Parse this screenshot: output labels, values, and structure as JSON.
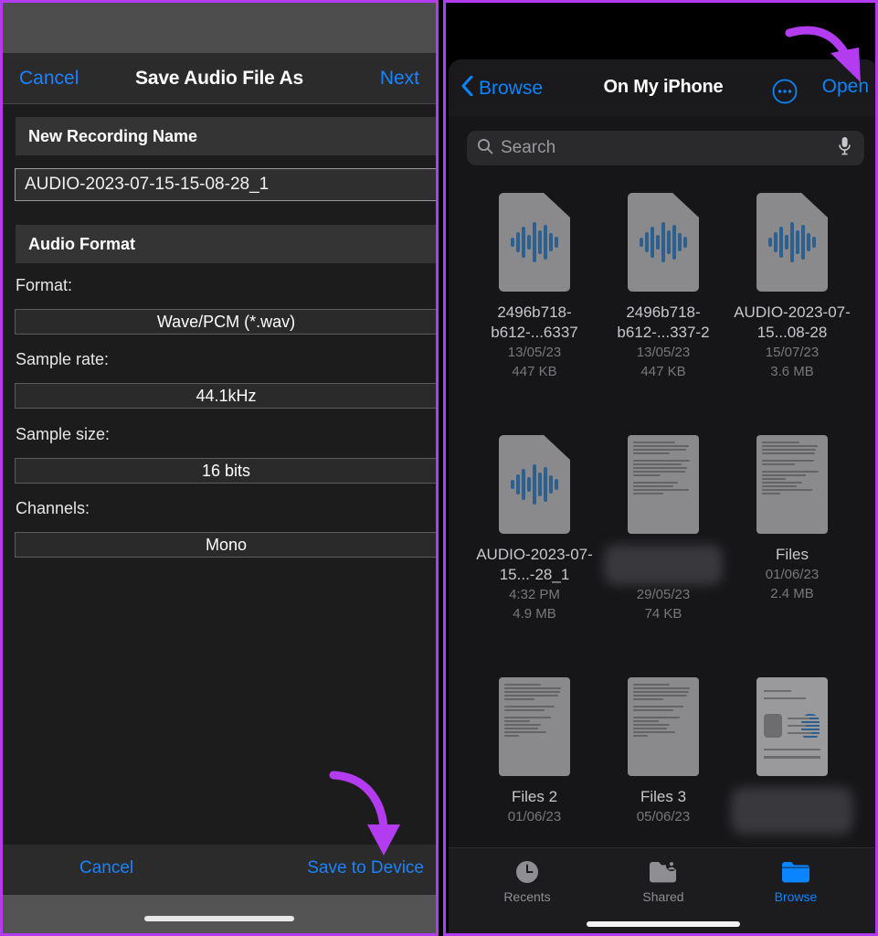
{
  "annotation": {
    "arrow_color": "#b43cf0",
    "border_color": "#b43cf0"
  },
  "left_panel": {
    "header": {
      "cancel_label": "Cancel",
      "title": "Save Audio File As",
      "next_label": "Next"
    },
    "name_section": {
      "section_header": "New Recording Name",
      "input_value": "AUDIO-2023-07-15-15-08-28_1"
    },
    "format_section": {
      "section_header": "Audio Format",
      "fields": [
        {
          "label": "Format:",
          "value": "Wave/PCM (*.wav)"
        },
        {
          "label": "Sample rate:",
          "value": "44.1kHz"
        },
        {
          "label": "Sample size:",
          "value": "16 bits"
        },
        {
          "label": "Channels:",
          "value": "Mono"
        }
      ]
    },
    "footer": {
      "cancel_label": "Cancel",
      "save_label": "Save to Device"
    },
    "accent_color": "#1a84ff"
  },
  "right_panel": {
    "header": {
      "back_label": "Browse",
      "back_icon": "chevron-left-icon",
      "title": "On My iPhone",
      "more_icon": "ellipsis-circle-icon",
      "open_label": "Open"
    },
    "search": {
      "placeholder": "Search",
      "search_icon": "magnifier-icon",
      "mic_icon": "microphone-icon"
    },
    "files": [
      {
        "name": "2496b718-b612-...6337",
        "date": "13/05/23",
        "size": "447 KB",
        "kind": "audio",
        "blurred": false
      },
      {
        "name": "2496b718-b612-...337-2",
        "date": "13/05/23",
        "size": "447 KB",
        "kind": "audio",
        "blurred": false
      },
      {
        "name": "AUDIO-2023-07-15...08-28",
        "date": "15/07/23",
        "size": "3.6 MB",
        "kind": "audio",
        "blurred": false
      },
      {
        "name": "AUDIO-2023-07-15...-28_1",
        "date": "4:32 PM",
        "size": "4.9 MB",
        "kind": "audio",
        "blurred": false
      },
      {
        "name": "",
        "date": "29/05/23",
        "size": "74 KB",
        "kind": "document",
        "blurred": true
      },
      {
        "name": "Files",
        "date": "01/06/23",
        "size": "2.4 MB",
        "kind": "document",
        "blurred": false
      },
      {
        "name": "Files 2",
        "date": "01/06/23",
        "size": "",
        "kind": "document",
        "blurred": false
      },
      {
        "name": "Files 3",
        "date": "05/06/23",
        "size": "",
        "kind": "document",
        "blurred": false
      },
      {
        "name": "",
        "date": "",
        "size": "",
        "kind": "idcard",
        "blurred": true
      }
    ],
    "tabs": [
      {
        "label": "Recents",
        "icon": "clock-icon",
        "active": false
      },
      {
        "label": "Shared",
        "icon": "folder-person-icon",
        "active": false
      },
      {
        "label": "Browse",
        "icon": "folder-icon",
        "active": true
      }
    ],
    "accent_color": "#0a84ff"
  }
}
